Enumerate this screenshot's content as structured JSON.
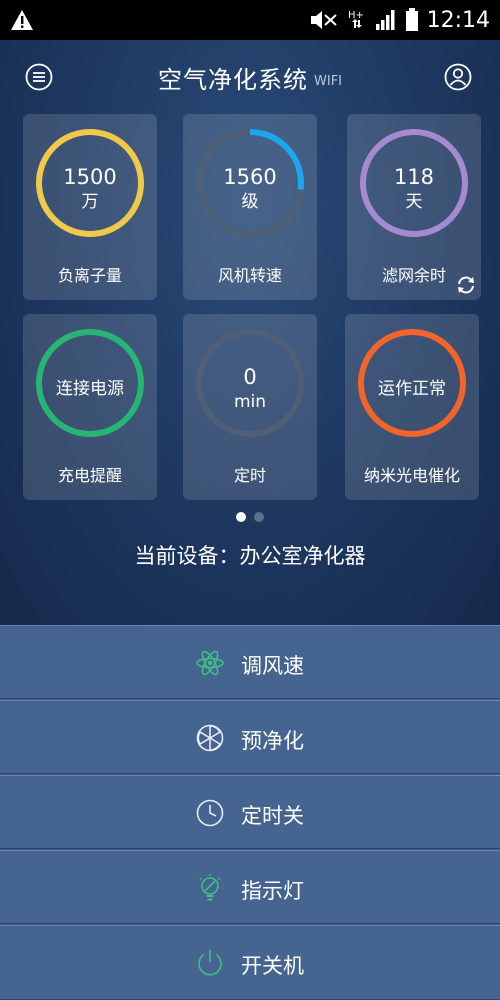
{
  "status_bar": {
    "time": "12:14",
    "icons": [
      "warning-icon",
      "mute-icon",
      "hplus-data-icon",
      "signal-icon",
      "battery-icon"
    ]
  },
  "header": {
    "title": "空气净化系统",
    "subtitle": "WIFI",
    "icons": [
      "menu-icon",
      "user-icon"
    ]
  },
  "cards": [
    {
      "value": "1500",
      "unit": "万",
      "label": "负离子量",
      "ring_color": "#f1c94a",
      "fill": 1.0
    },
    {
      "value": "1560",
      "unit": "级",
      "label": "风机转速",
      "ring_color": "#1da5f0",
      "fill": 0.27
    },
    {
      "value": "118",
      "unit": "天",
      "label": "滤网余时",
      "ring_color": "#a58ad2",
      "fill": 1.0
    },
    {
      "value": "连接电源",
      "unit": "",
      "label": "充电提醒",
      "ring_color": "#27b574",
      "fill": 1.0
    },
    {
      "value": "0",
      "unit": "min",
      "label": "定时",
      "ring_color": "#4f5f75",
      "fill": 0.0
    },
    {
      "value": "运作正常",
      "unit": "",
      "label": "纳米光电催化",
      "ring_color": "#f2642a",
      "fill": 1.0
    }
  ],
  "pager": {
    "pages": 2,
    "active": 0
  },
  "device": {
    "label": "当前设备",
    "separator": "：",
    "name": "办公室净化器"
  },
  "menu": [
    {
      "label": "调风速",
      "icon": "fan-icon",
      "color": "#3fbf86"
    },
    {
      "label": "预净化",
      "icon": "purify-icon",
      "color": "#e6ecf5"
    },
    {
      "label": "定时关",
      "icon": "clock-icon",
      "color": "#e6ecf5"
    },
    {
      "label": "指示灯",
      "icon": "bulb-icon",
      "color": "#3fbf86"
    },
    {
      "label": "开关机",
      "icon": "power-icon",
      "color": "#3fbf86"
    }
  ],
  "colors": {
    "ring_track": "#4f5f75",
    "menu_bg": "#45648f",
    "accent_green": "#3fbf86"
  }
}
